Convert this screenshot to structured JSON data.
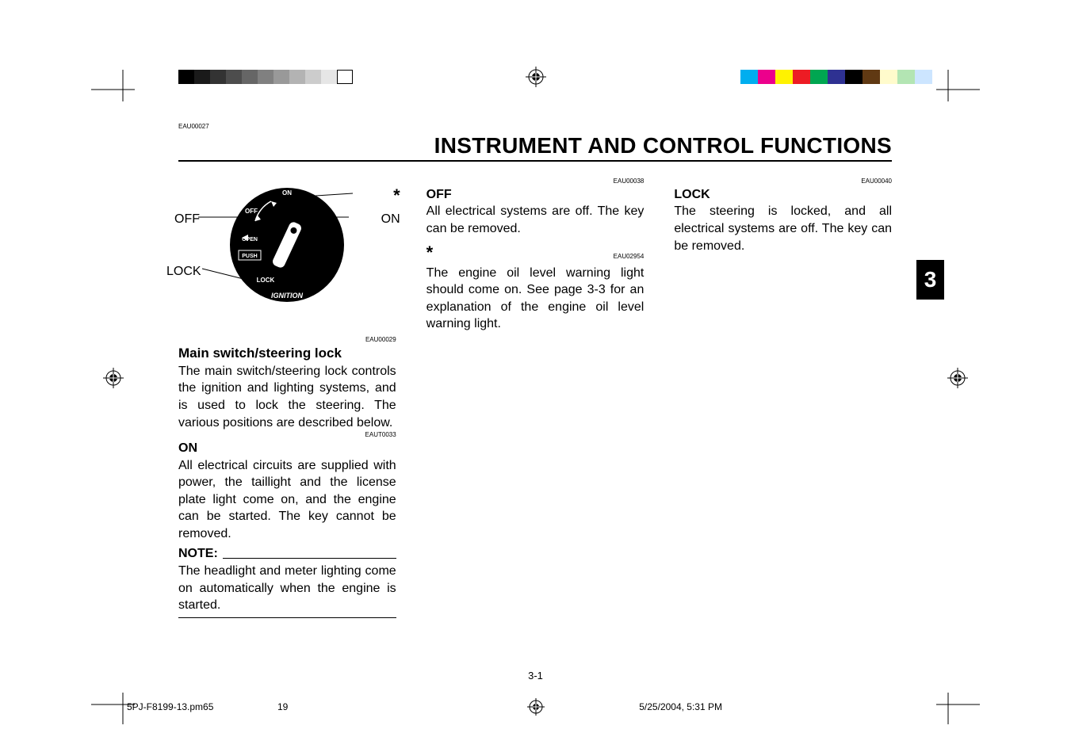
{
  "header_code": "EAU00027",
  "title": "INSTRUMENT AND CONTROL FUNCTIONS",
  "chapter_number": "3",
  "page_number": "3-1",
  "ignition": {
    "star_marker": "*",
    "labels": {
      "on": "ON",
      "off": "OFF",
      "lock": "LOCK",
      "open": "OPEN",
      "push": "PUSH",
      "ignition": "IGNITION"
    },
    "pointer_off": "OFF",
    "pointer_on": "ON",
    "pointer_lock": "LOCK"
  },
  "col1": {
    "code1": "EAU00029",
    "heading": "Main switch/steering lock",
    "para1": "The main switch/steering lock controls the ignition and lighting systems, and is used to lock the steering. The various positions are described below.",
    "code2": "EAUT0033",
    "on_head": "ON",
    "on_text": "All electrical circuits are supplied with power, the taillight and the license plate light come on, and the engine can be started. The key cannot be removed.",
    "note_label": "NOTE:",
    "note_text": "The headlight and meter lighting come on automatically when the engine is started."
  },
  "col2": {
    "code1": "EAU00038",
    "off_head": "OFF",
    "off_text": "All electrical systems are off. The key can be removed.",
    "star": "*",
    "code2": "EAU02954",
    "star_text": "The engine oil level warning light should come on. See page 3-3 for an explanation of the engine oil level warning light."
  },
  "col3": {
    "code1": "EAU00040",
    "lock_head": "LOCK",
    "lock_text": "The steering is locked, and all electrical systems are off. The key can be removed."
  },
  "footer": {
    "filename": "5PJ-F8199-13.pm65",
    "page": "19",
    "datetime": "5/25/2004, 5:31 PM"
  }
}
